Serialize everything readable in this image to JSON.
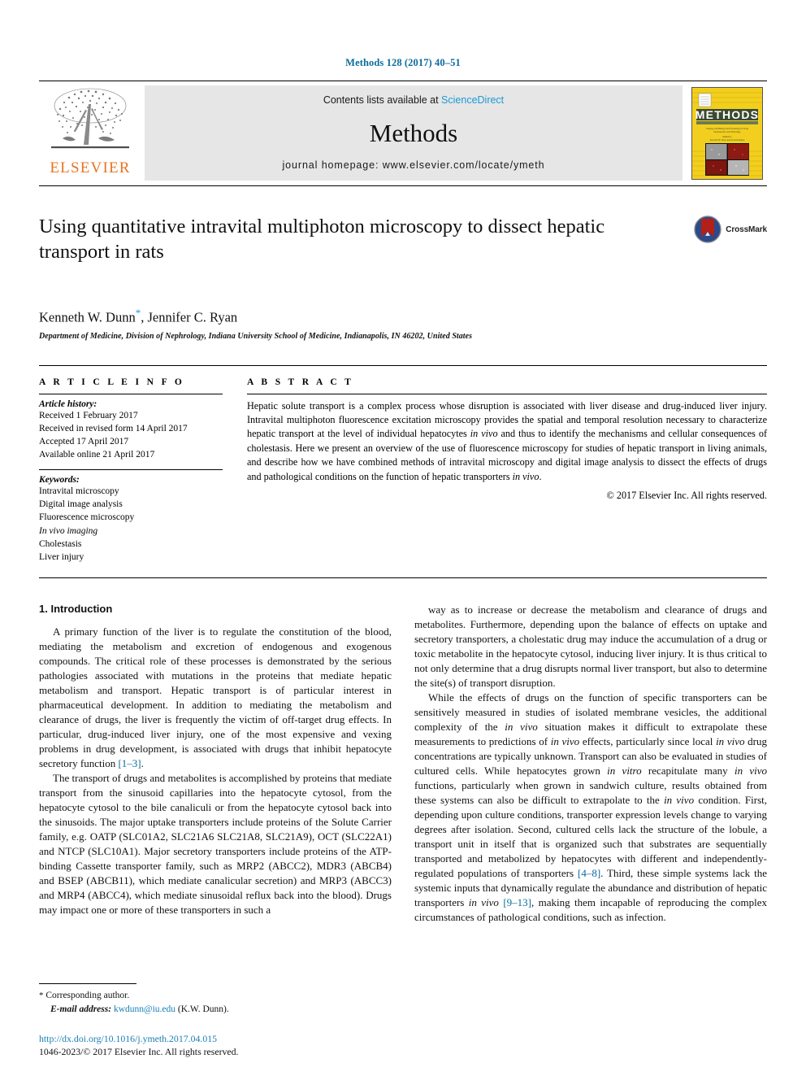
{
  "running_head": "Methods 128 (2017) 40–51",
  "masthead": {
    "publisher_name": "ELSEVIER",
    "contents_prefix": "Contents lists available at ",
    "contents_link": "ScienceDirect",
    "journal_name": "Methods",
    "homepage": "journal homepage: www.elsevier.com/locate/ymeth",
    "cover_title": "METHODS"
  },
  "article": {
    "title": "Using quantitative intravital multiphoton microscopy to dissect hepatic transport in rats",
    "crossmark_label": "CrossMark",
    "authors": "Kenneth W. Dunn",
    "authors_rest": ", Jennifer C. Ryan",
    "corresponding_marker": "*",
    "affiliation": "Department of Medicine, Division of Nephrology, Indiana University School of Medicine, Indianapolis, IN 46202, United States"
  },
  "article_info": {
    "heading": "A R T I C L E   I N F O",
    "history_label": "Article history:",
    "history": [
      "Received 1 February 2017",
      "Received in revised form 14 April 2017",
      "Accepted 17 April 2017",
      "Available online 21 April 2017"
    ],
    "keywords_label": "Keywords:",
    "keywords": [
      "Intravital microscopy",
      "Digital image analysis",
      "Fluorescence microscopy",
      "In vivo imaging",
      "Cholestasis",
      "Liver injury"
    ]
  },
  "abstract": {
    "heading": "A B S T R A C T",
    "text": "Hepatic solute transport is a complex process whose disruption is associated with liver disease and drug-induced liver injury. Intravital multiphoton fluorescence excitation microscopy provides the spatial and temporal resolution necessary to characterize hepatic transport at the level of individual hepatocytes in vivo and thus to identify the mechanisms and cellular consequences of cholestasis. Here we present an overview of the use of fluorescence microscopy for studies of hepatic transport in living animals, and describe how we have combined methods of intravital microscopy and digital image analysis to dissect the effects of drugs and pathological conditions on the function of hepatic transporters in vivo.",
    "copyright": "© 2017 Elsevier Inc. All rights reserved."
  },
  "introduction": {
    "section_title": "1. Introduction",
    "paragraphs_left": [
      "A primary function of the liver is to regulate the constitution of the blood, mediating the metabolism and excretion of endogenous and exogenous compounds. The critical role of these processes is demonstrated by the serious pathologies associated with mutations in the proteins that mediate hepatic metabolism and transport. Hepatic transport is of particular interest in pharmaceutical development. In addition to mediating the metabolism and clearance of drugs, the liver is frequently the victim of off-target drug effects. In particular, drug-induced liver injury, one of the most expensive and vexing problems in drug development, is associated with drugs that inhibit hepatocyte secretory function [1–3].",
      "The transport of drugs and metabolites is accomplished by proteins that mediate transport from the sinusoid capillaries into the hepatocyte cytosol, from the hepatocyte cytosol to the bile canaliculi or from the hepatocyte cytosol back into the sinusoids. The major uptake transporters include proteins of the Solute Carrier family, e.g. OATP (SLC01A2, SLC21A6 SLC21A8, SLC21A9), OCT (SLC22A1) and NTCP (SLC10A1). Major secretory transporters include proteins of the ATP-binding Cassette transporter family, such as MRP2 (ABCC2), MDR3 (ABCB4) and BSEP (ABCB11), which mediate canalicular secretion) and MRP3 (ABCC3) and MRP4 (ABCC4), which mediate sinusoidal reflux back into the blood). Drugs may impact one or more of these transporters in such a"
    ],
    "paragraphs_right": [
      "way as to increase or decrease the metabolism and clearance of drugs and metabolites. Furthermore, depending upon the balance of effects on uptake and secretory transporters, a cholestatic drug may induce the accumulation of a drug or toxic metabolite in the hepatocyte cytosol, inducing liver injury. It is thus critical to not only determine that a drug disrupts normal liver transport, but also to determine the site(s) of transport disruption.",
      "While the effects of drugs on the function of specific transporters can be sensitively measured in studies of isolated membrane vesicles, the additional complexity of the in vivo situation makes it difficult to extrapolate these measurements to predictions of in vivo effects, particularly since local in vivo drug concentrations are typically unknown. Transport can also be evaluated in studies of cultured cells. While hepatocytes grown in vitro recapitulate many in vivo functions, particularly when grown in sandwich culture, results obtained from these systems can also be difficult to extrapolate to the in vivo condition. First, depending upon culture conditions, transporter expression levels change to varying degrees after isolation. Second, cultured cells lack the structure of the lobule, a transport unit in itself that is organized such that substrates are sequentially transported and metabolized by hepatocytes with different and independently-regulated populations of transporters [4–8]. Third, these simple systems lack the systemic inputs that dynamically regulate the abundance and distribution of hepatic transporters in vivo [9–13], making them incapable of reproducing the complex circumstances of pathological conditions, such as infection."
    ]
  },
  "footnotes": {
    "corresponding_marker": "*",
    "corresponding_text": "Corresponding author.",
    "email_label": "E-mail address:",
    "email": "kwdunn@iu.edu",
    "email_suffix": "(K.W. Dunn).",
    "doi": "http://dx.doi.org/10.1016/j.ymeth.2017.04.015",
    "issn_copyright": "1046-2023/© 2017 Elsevier Inc. All rights reserved."
  },
  "colors": {
    "link_blue": "#1a7fb5",
    "running_head_blue": "#0b6c9b",
    "elsevier_orange": "#e87422",
    "band_gray": "#e6e6e6"
  }
}
